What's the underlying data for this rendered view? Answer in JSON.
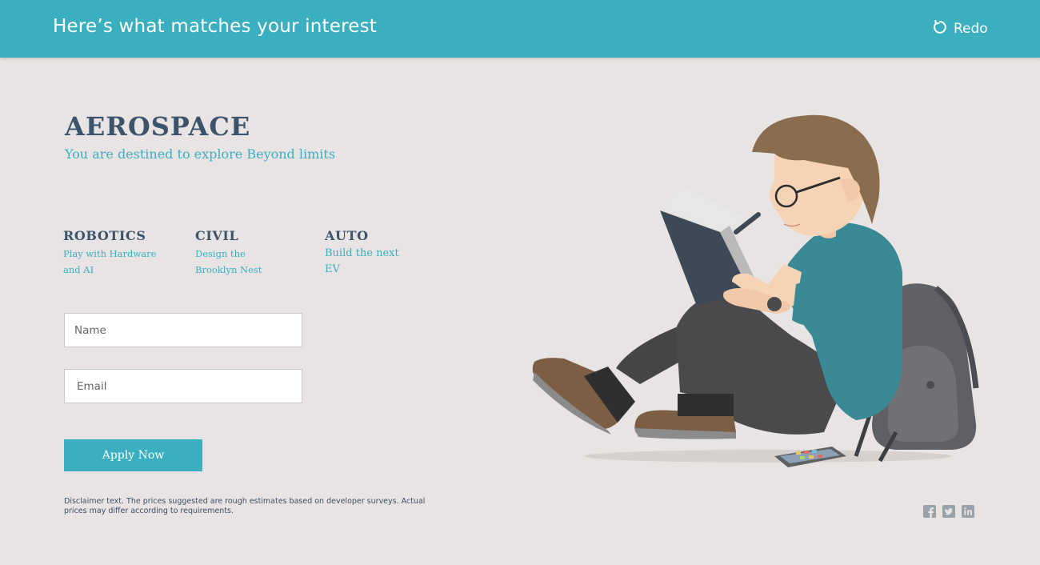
{
  "header": {
    "title": "Here’s what matches your interest",
    "redo_label": "Redo",
    "redo_icon": "redo-icon"
  },
  "result": {
    "title": "AEROSPACE",
    "subtitle": "You are destined to explore Beyond limits"
  },
  "fields": [
    {
      "name": "ROBOTICS",
      "desc": "Play with Hardware and AI"
    },
    {
      "name": "CIVIL",
      "desc": "Design the Brooklyn Nest"
    },
    {
      "name": "AUTO",
      "desc": "Build the next EV"
    }
  ],
  "form": {
    "name_placeholder": "Name",
    "email_placeholder": "Email",
    "apply_label": "Apply Now"
  },
  "disclaimer": "Disclaimer text. The prices suggested are rough estimates  based on developer surveys. Actual prices  may differ according to requirements.",
  "social": [
    "facebook-icon",
    "twitter-icon",
    "linkedin-icon"
  ],
  "colors": {
    "accent": "#3aafbf",
    "heading": "#3d536c",
    "background": "#e8e4e3"
  }
}
